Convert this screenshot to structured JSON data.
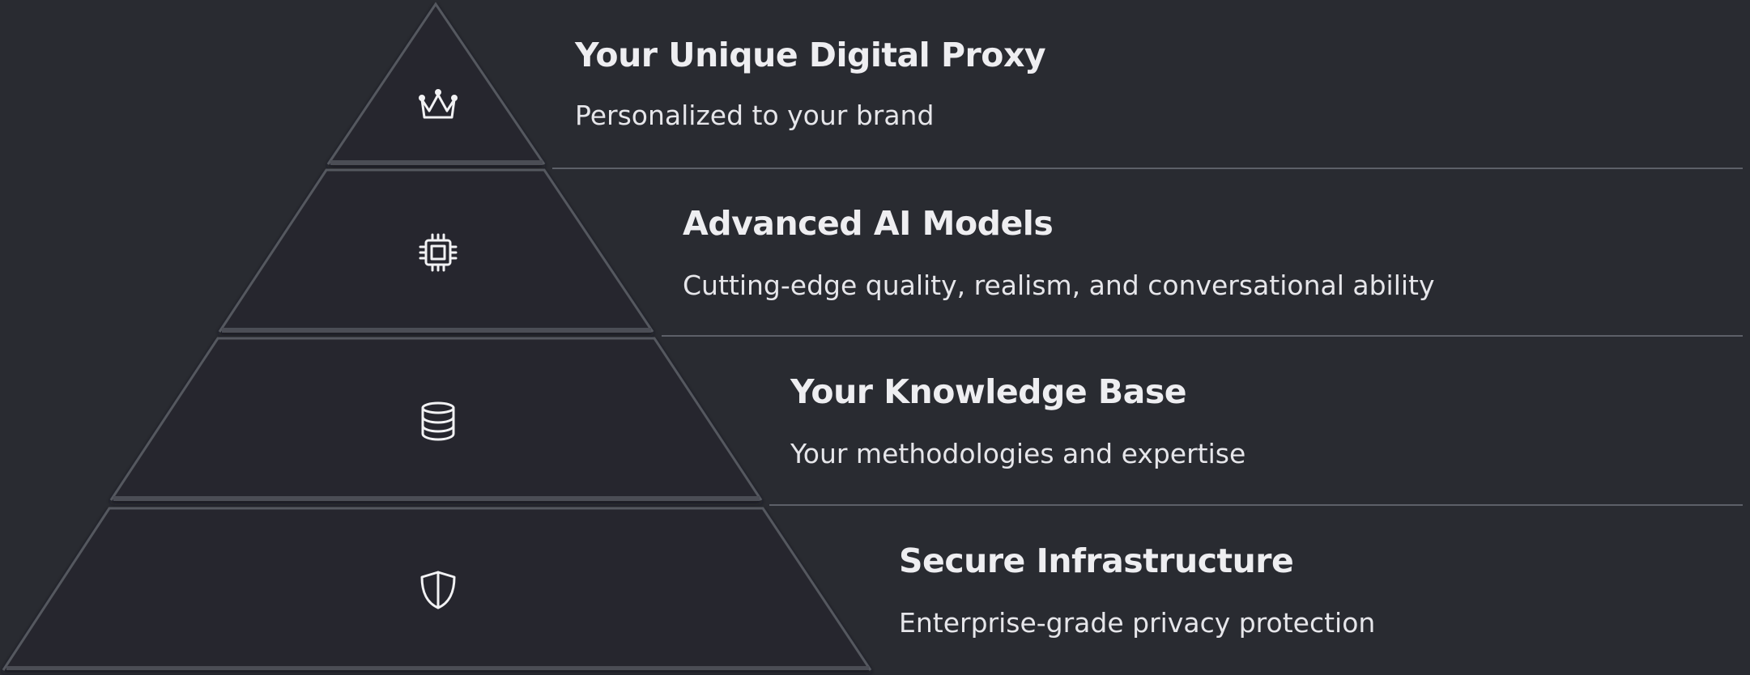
{
  "layers": [
    {
      "title": "Your Unique Digital Proxy",
      "description": "Personalized to your brand",
      "icon": "crown-icon"
    },
    {
      "title": "Advanced AI Models",
      "description": "Cutting-edge quality, realism, and conversational ability",
      "icon": "chip-icon"
    },
    {
      "title": "Your Knowledge Base",
      "description": "Your methodologies and expertise",
      "icon": "database-icon"
    },
    {
      "title": "Secure Infrastructure",
      "description": "Enterprise-grade privacy protection",
      "icon": "shield-icon"
    }
  ],
  "colors": {
    "background": "#292b31",
    "layer_fill": "#25272d",
    "edge_highlight": "#5a5d65",
    "divider": "#5d6068",
    "text": "#eeeef1",
    "icon": "#f2f2f4"
  }
}
